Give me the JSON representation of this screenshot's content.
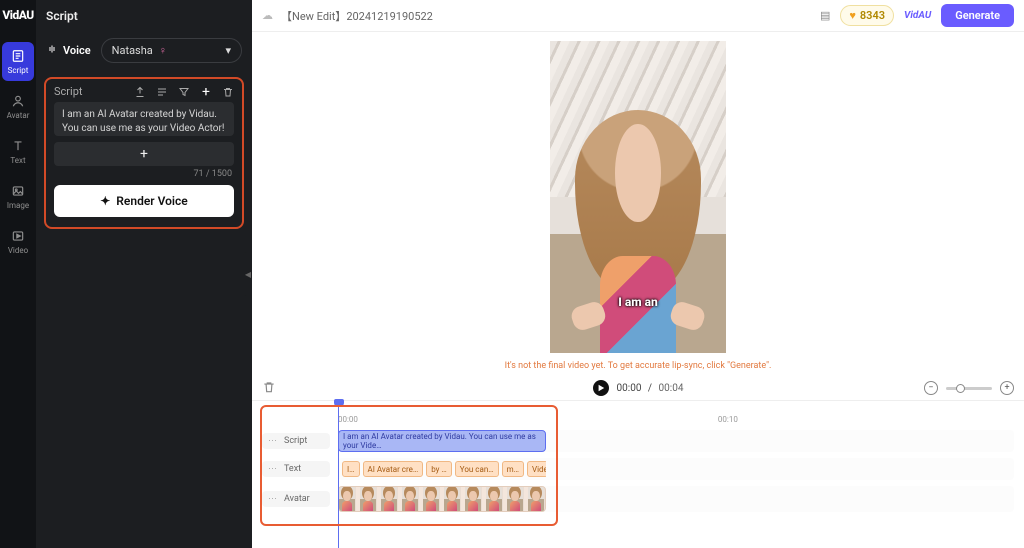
{
  "app": {
    "logo": "VidAU"
  },
  "rail": [
    {
      "id": "script",
      "label": "Script",
      "active": true
    },
    {
      "id": "avatar",
      "label": "Avatar",
      "active": false
    },
    {
      "id": "text",
      "label": "Text",
      "active": false
    },
    {
      "id": "image",
      "label": "Image",
      "active": false
    },
    {
      "id": "video",
      "label": "Video",
      "active": false
    }
  ],
  "side": {
    "title": "Script",
    "voice_label": "Voice",
    "voice_name": "Natasha",
    "script_header": "Script",
    "script_text": "I am an AI Avatar created by Vidau. You can use me as your Video Actor!",
    "count": "71 / 1500",
    "render_label": "Render Voice"
  },
  "top": {
    "project_prefix": "【New Edit】",
    "project_id": "20241219190522",
    "credits": "8343",
    "watermark": "VidAU",
    "generate_label": "Generate"
  },
  "preview": {
    "caption": "I am an",
    "note": "It's not the final video yet. To get accurate lip-sync, click \"Generate\"."
  },
  "controls": {
    "current": "00:00",
    "sep": "/",
    "duration": "00:04"
  },
  "timeline": {
    "tick0": "00:00",
    "tick1": "00:10",
    "rows": {
      "script_label": "Script",
      "text_label": "Text",
      "avatar_label": "Avatar",
      "script_clip": "I am an AI Avatar created by Vidau. You can use me as your Vide…",
      "text_chips": [
        "I…",
        "AI Avatar cre…",
        "by …",
        "You can…",
        "m…",
        "Vide…"
      ]
    }
  }
}
